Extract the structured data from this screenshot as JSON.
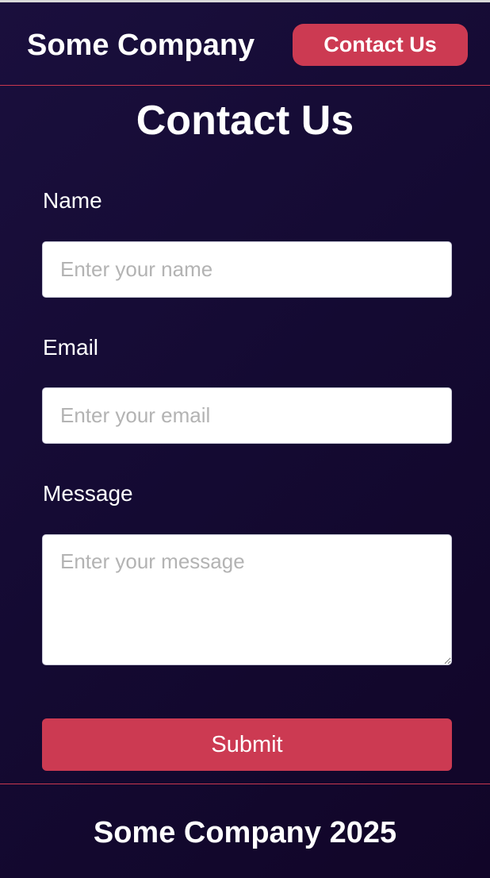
{
  "header": {
    "brand": "Some Company",
    "nav_button": "Contact Us"
  },
  "main": {
    "title": "Contact Us",
    "form": {
      "name": {
        "label": "Name",
        "placeholder": "Enter your name",
        "value": ""
      },
      "email": {
        "label": "Email",
        "placeholder": "Enter your email",
        "value": ""
      },
      "message": {
        "label": "Message",
        "placeholder": "Enter your message",
        "value": ""
      },
      "submit_label": "Submit"
    }
  },
  "footer": {
    "text": "Some Company 2025"
  },
  "colors": {
    "background": "#140a30",
    "accent": "#cc3a52",
    "text": "#ffffff"
  }
}
